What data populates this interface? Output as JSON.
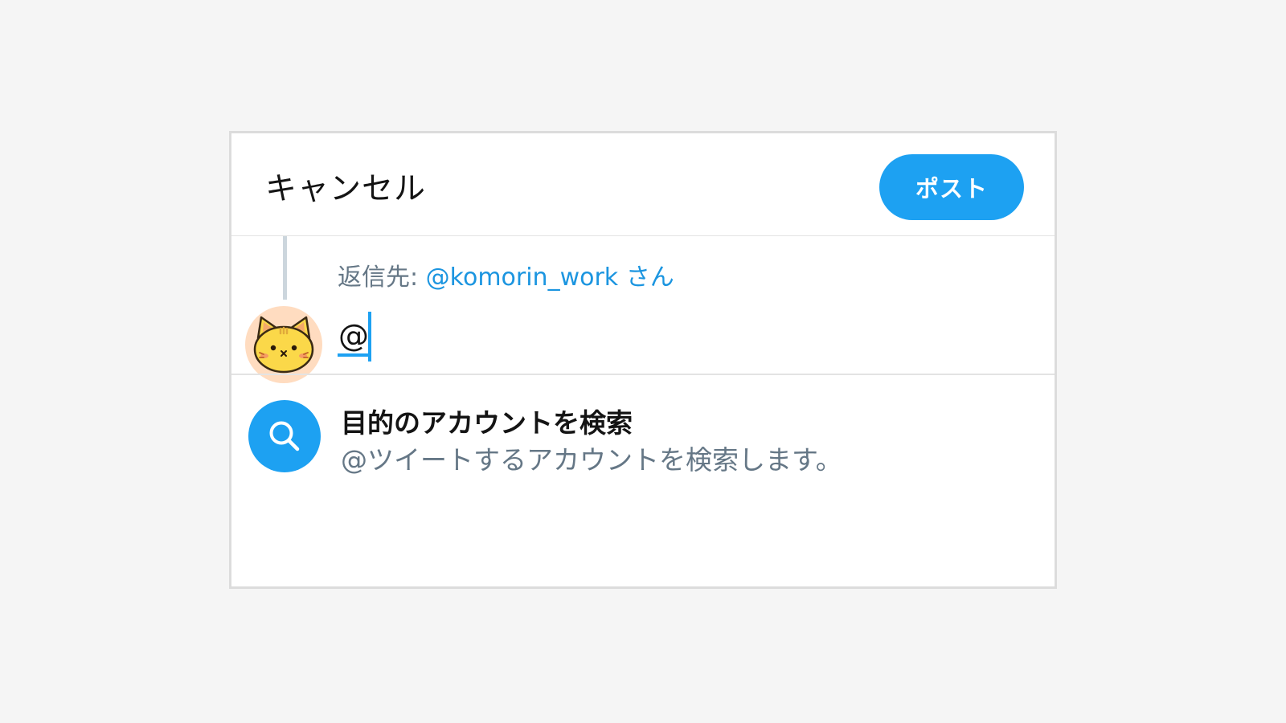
{
  "header": {
    "cancel_label": "キャンセル",
    "post_label": "ポスト"
  },
  "reply": {
    "prefix": "返信先:",
    "mention": "@komorin_work",
    "suffix": "さん"
  },
  "compose": {
    "text": "@"
  },
  "suggestion": {
    "icon": "search-icon",
    "title": "目的のアカウントを検索",
    "subtitle": "@ツイートするアカウントを検索します。"
  },
  "colors": {
    "accent": "#1da1f2",
    "link": "#1b95e0",
    "muted": "#657786",
    "avatar_bg": "#ffdcc0",
    "avatar_face": "#fbd849"
  }
}
